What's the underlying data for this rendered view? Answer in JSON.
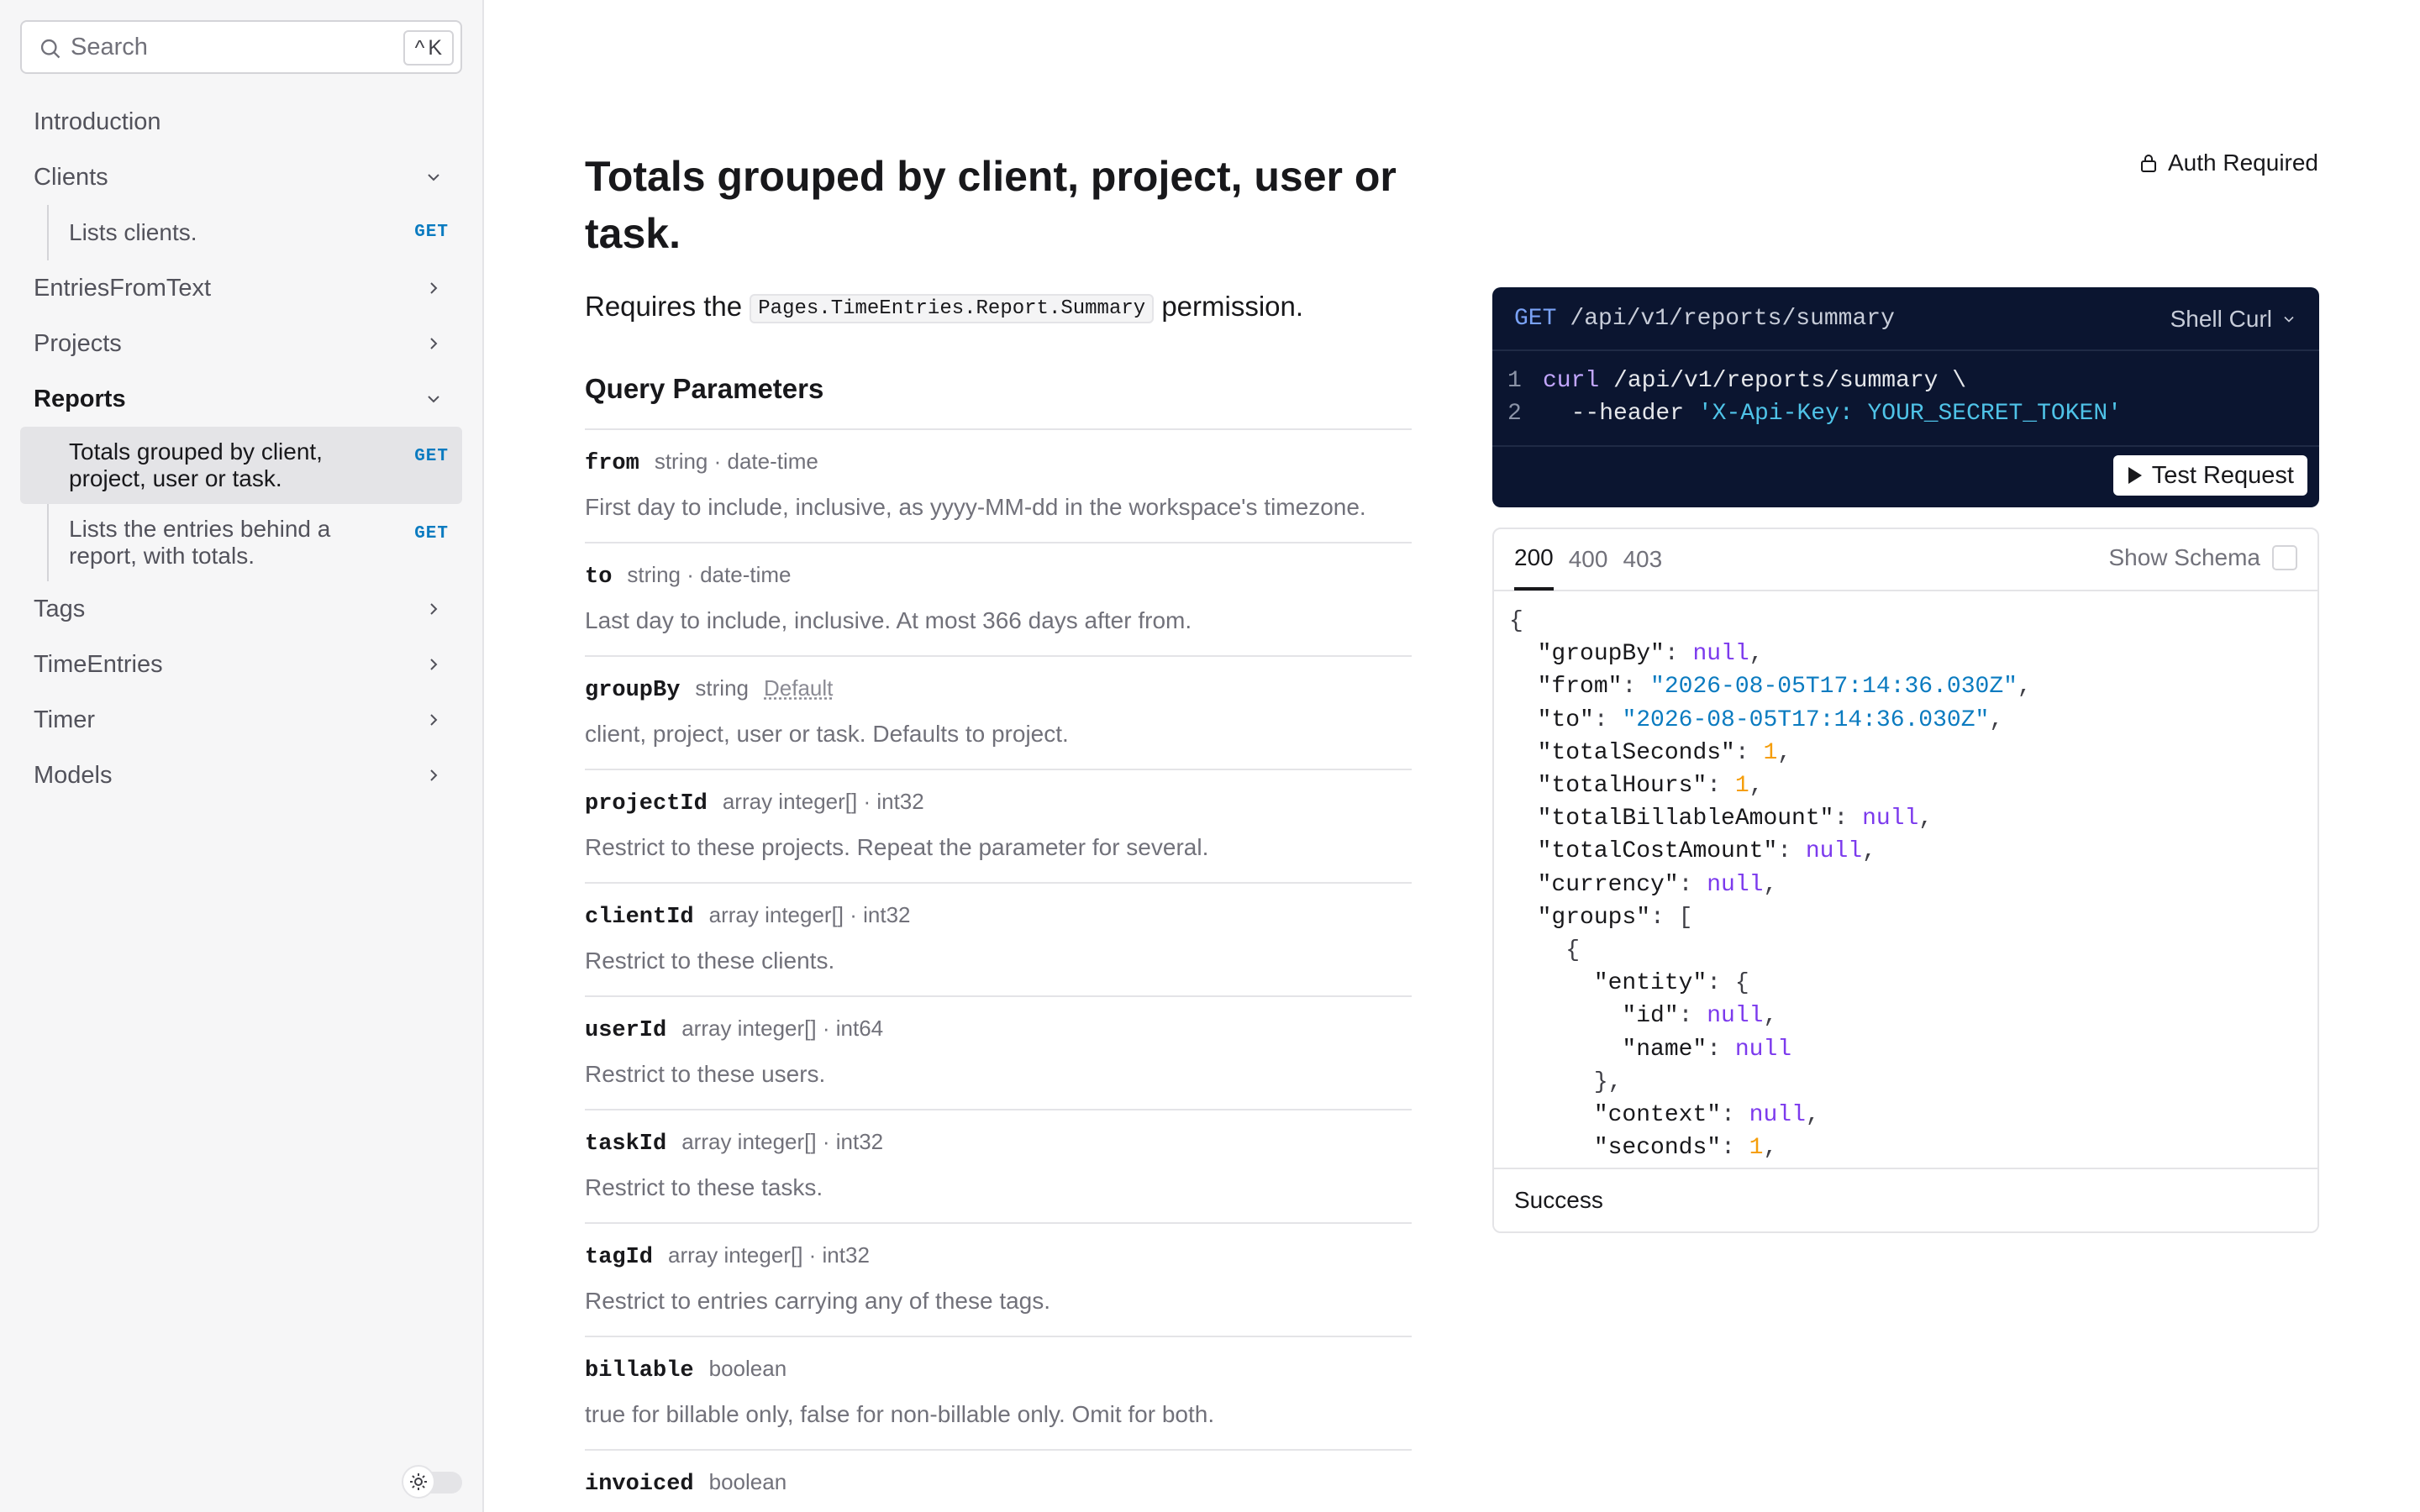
{
  "search": {
    "placeholder": "Search",
    "shortcut_mod": "^",
    "shortcut_key": "K"
  },
  "sidebar": {
    "items": [
      {
        "label": "Introduction"
      },
      {
        "label": "Clients",
        "expanded": true,
        "children": [
          {
            "label": "Lists clients.",
            "method": "GET"
          }
        ]
      },
      {
        "label": "EntriesFromText"
      },
      {
        "label": "Projects"
      },
      {
        "label": "Reports",
        "expanded": true,
        "active": true,
        "children": [
          {
            "label": "Totals grouped by client, project, user or task.",
            "method": "GET",
            "selected": true
          },
          {
            "label": "Lists the entries behind a report, with totals.",
            "method": "GET"
          }
        ]
      },
      {
        "label": "Tags"
      },
      {
        "label": "TimeEntries"
      },
      {
        "label": "Timer"
      },
      {
        "label": "Models"
      }
    ]
  },
  "main": {
    "title": "Totals grouped by client, project, user or task.",
    "permission_prefix": "Requires the",
    "permission_code": "Pages.TimeEntries.Report.Summary",
    "permission_suffix": "permission.",
    "query_heading": "Query Parameters",
    "auth_label": "Auth Required",
    "params": [
      {
        "name": "from",
        "type": "string · date-time",
        "desc": "First day to include, inclusive, as yyyy-MM-dd in the workspace's timezone."
      },
      {
        "name": "to",
        "type": "string · date-time",
        "desc": "Last day to include, inclusive. At most 366 days after from."
      },
      {
        "name": "groupBy",
        "type": "string",
        "default": "Default",
        "desc": "client, project, user or task. Defaults to project."
      },
      {
        "name": "projectId",
        "type": "array integer[] · int32",
        "desc": "Restrict to these projects. Repeat the parameter for several."
      },
      {
        "name": "clientId",
        "type": "array integer[] · int32",
        "desc": "Restrict to these clients."
      },
      {
        "name": "userId",
        "type": "array integer[] · int64",
        "desc": "Restrict to these users."
      },
      {
        "name": "taskId",
        "type": "array integer[] · int32",
        "desc": "Restrict to these tasks."
      },
      {
        "name": "tagId",
        "type": "array integer[] · int32",
        "desc": "Restrict to entries carrying any of these tags."
      },
      {
        "name": "billable",
        "type": "boolean",
        "desc": "true for billable only, false for non-billable only. Omit for both."
      },
      {
        "name": "invoiced",
        "type": "boolean",
        "desc": ""
      }
    ]
  },
  "request": {
    "method": "GET",
    "path": "/api/v1/reports/summary",
    "language": "Shell Curl",
    "line1_num": "1",
    "line1_cmd": "curl",
    "line1_rest": " /api/v1/reports/summary \\",
    "line2_num": "2",
    "line2_flag": "  --header ",
    "line2_str": "'X-Api-Key: YOUR_SECRET_TOKEN'",
    "test_label": "Test Request"
  },
  "response": {
    "tabs": [
      "200",
      "400",
      "403"
    ],
    "active_tab": "200",
    "schema_label": "Show Schema",
    "footer": "Success",
    "from_value": "\"2026-08-05T17:14:36.030Z\"",
    "to_value": "\"2026-08-05T17:14:36.030Z\""
  },
  "colors": {
    "accent_get": "#0b7bc0",
    "code_bg": "#0b1530",
    "json_null": "#7c3aed",
    "json_string": "#0b7bc0",
    "json_number": "#f59e0b"
  }
}
